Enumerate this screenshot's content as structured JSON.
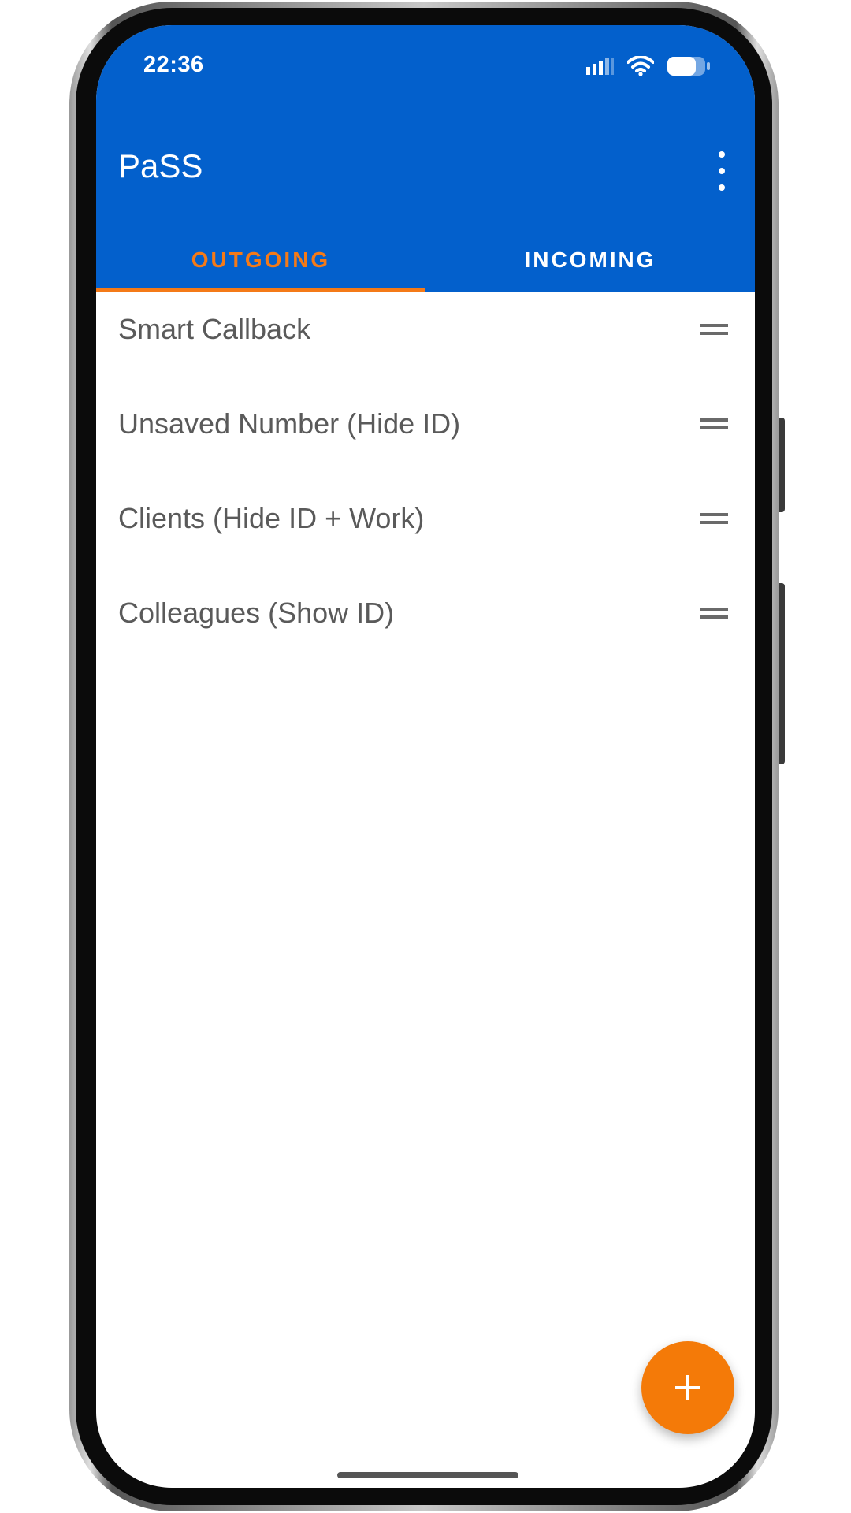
{
  "status_bar": {
    "time": "22:36",
    "icons": [
      "signal-icon",
      "wifi-icon",
      "battery-icon"
    ]
  },
  "app_bar": {
    "title": "PaSS",
    "menu_icon": "more-vert-icon"
  },
  "tabs": [
    {
      "label": "OUTGOING",
      "active": true
    },
    {
      "label": "INCOMING",
      "active": false
    }
  ],
  "list": {
    "items": [
      {
        "label": "Smart Callback"
      },
      {
        "label": "Unsaved Number (Hide ID)"
      },
      {
        "label": "Clients (Hide ID + Work)"
      },
      {
        "label": "Colleagues (Show ID)"
      }
    ],
    "handle_icon": "drag-handle-icon"
  },
  "fab": {
    "icon": "plus-icon"
  },
  "colors": {
    "primary": "#0360cc",
    "accent": "#f47a18",
    "text": "#5a5a5a",
    "background": "#ffffff"
  }
}
